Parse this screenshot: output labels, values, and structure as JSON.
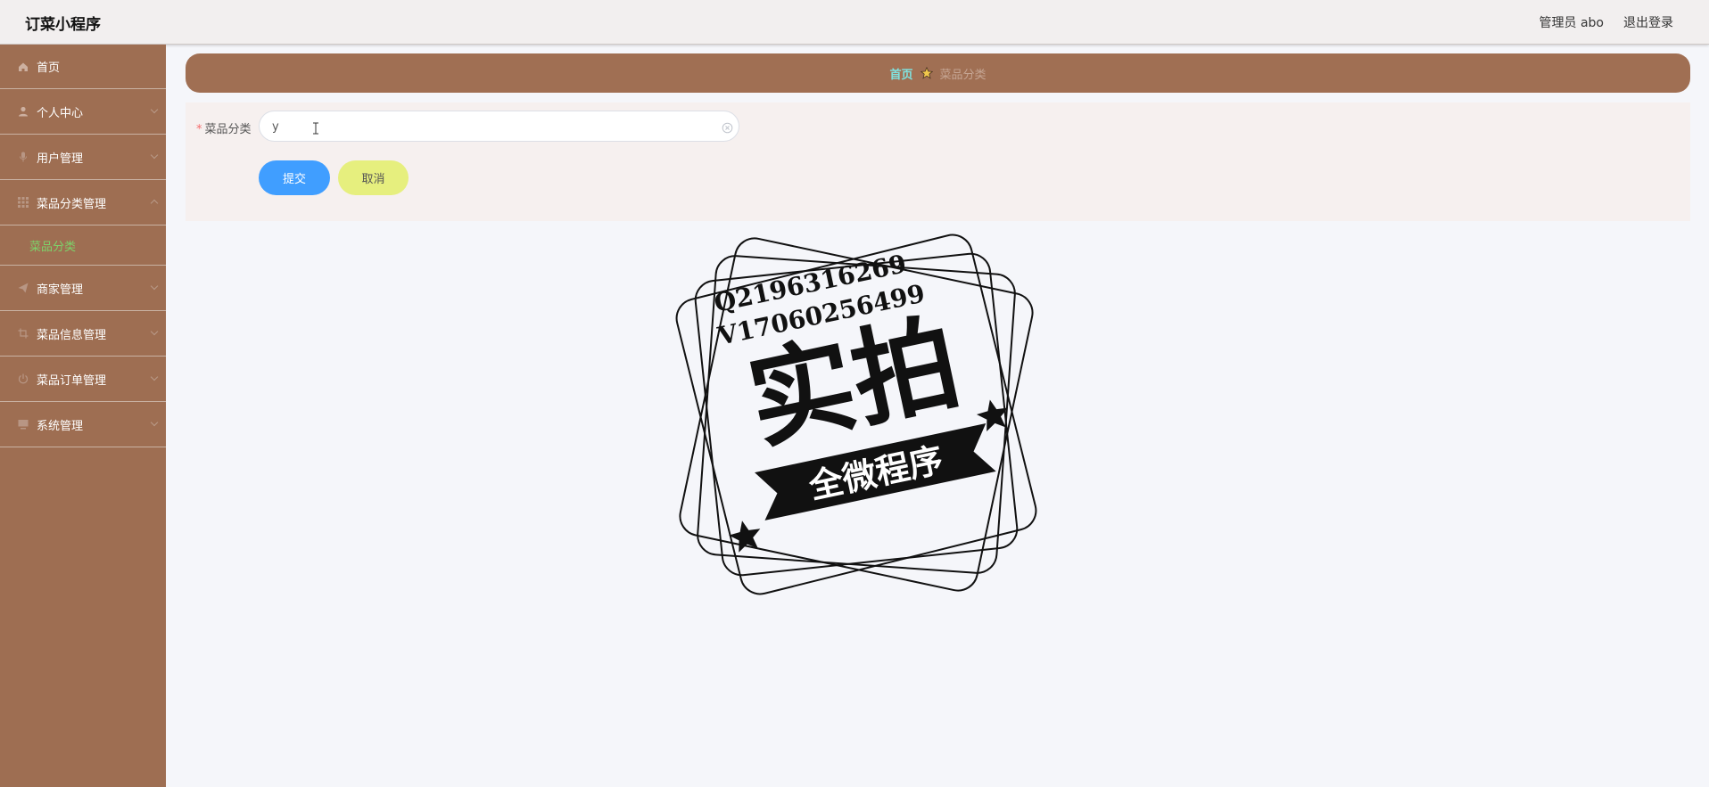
{
  "header": {
    "app_title": "订菜小程序",
    "user_label": "管理员 abo",
    "logout_label": "退出登录"
  },
  "sidebar": {
    "items": [
      {
        "label": "首页",
        "icon": "home-icon"
      },
      {
        "label": "个人中心",
        "icon": "user-icon"
      },
      {
        "label": "用户管理",
        "icon": "mic-icon"
      },
      {
        "label": "菜品分类管理",
        "icon": "grid-icon",
        "expanded": true
      },
      {
        "label": "商家管理",
        "icon": "send-icon"
      },
      {
        "label": "菜品信息管理",
        "icon": "crop-icon"
      },
      {
        "label": "菜品订单管理",
        "icon": "power-icon"
      },
      {
        "label": "系统管理",
        "icon": "monitor-icon"
      }
    ],
    "submenu": {
      "label": "菜品分类"
    }
  },
  "breadcrumb": {
    "home": "首页",
    "current": "菜品分类"
  },
  "form": {
    "category_label": "菜品分类",
    "category_value": "y",
    "submit_label": "提交",
    "cancel_label": "取消"
  },
  "watermark": {
    "line1": "Q2196316269",
    "line2": "V17060256499",
    "big": "实拍",
    "banner": "全微程序"
  },
  "colors": {
    "sidebar": "#9e6e52",
    "breadcrumb_bar": "#a06f53",
    "submenu_active": "#7dd36a",
    "primary_button": "#409eff",
    "cancel_button": "#e6ef7e"
  }
}
